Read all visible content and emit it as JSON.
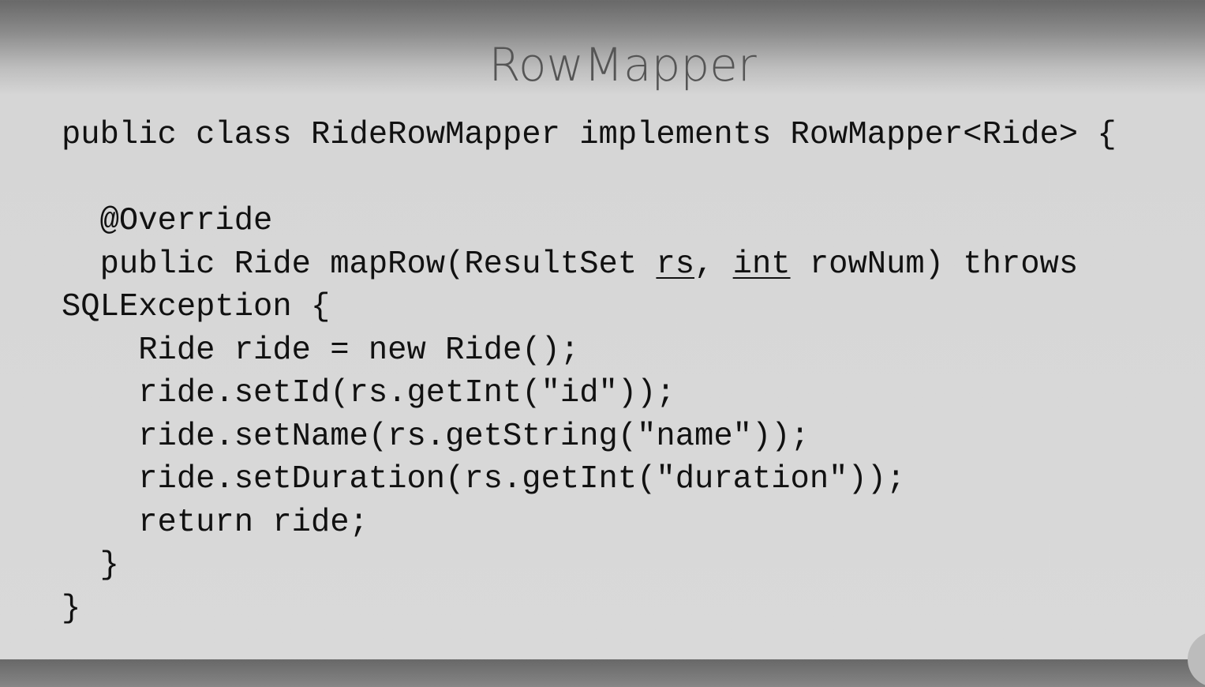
{
  "slide": {
    "title": "RowMapper",
    "code_lines": [
      [
        "public class RideRowMapper implements RowMapper<Ride> {"
      ],
      [
        ""
      ],
      [
        "  @Override"
      ],
      [
        "  public Ride mapRow(ResultSet ",
        "rs",
        ", ",
        "int",
        " rowNum) throws"
      ],
      [
        "SQLException {"
      ],
      [
        "    Ride ride = new Ride();"
      ],
      [
        "    ride.setId(rs.getInt(\"id\"));"
      ],
      [
        "    ride.setName(rs.getString(\"name\"));"
      ],
      [
        "    ride.setDuration(rs.getInt(\"duration\"));"
      ],
      [
        "    return ride;"
      ],
      [
        "  }"
      ],
      [
        "}"
      ]
    ],
    "logo_icon": "presenter-logo-icon"
  }
}
